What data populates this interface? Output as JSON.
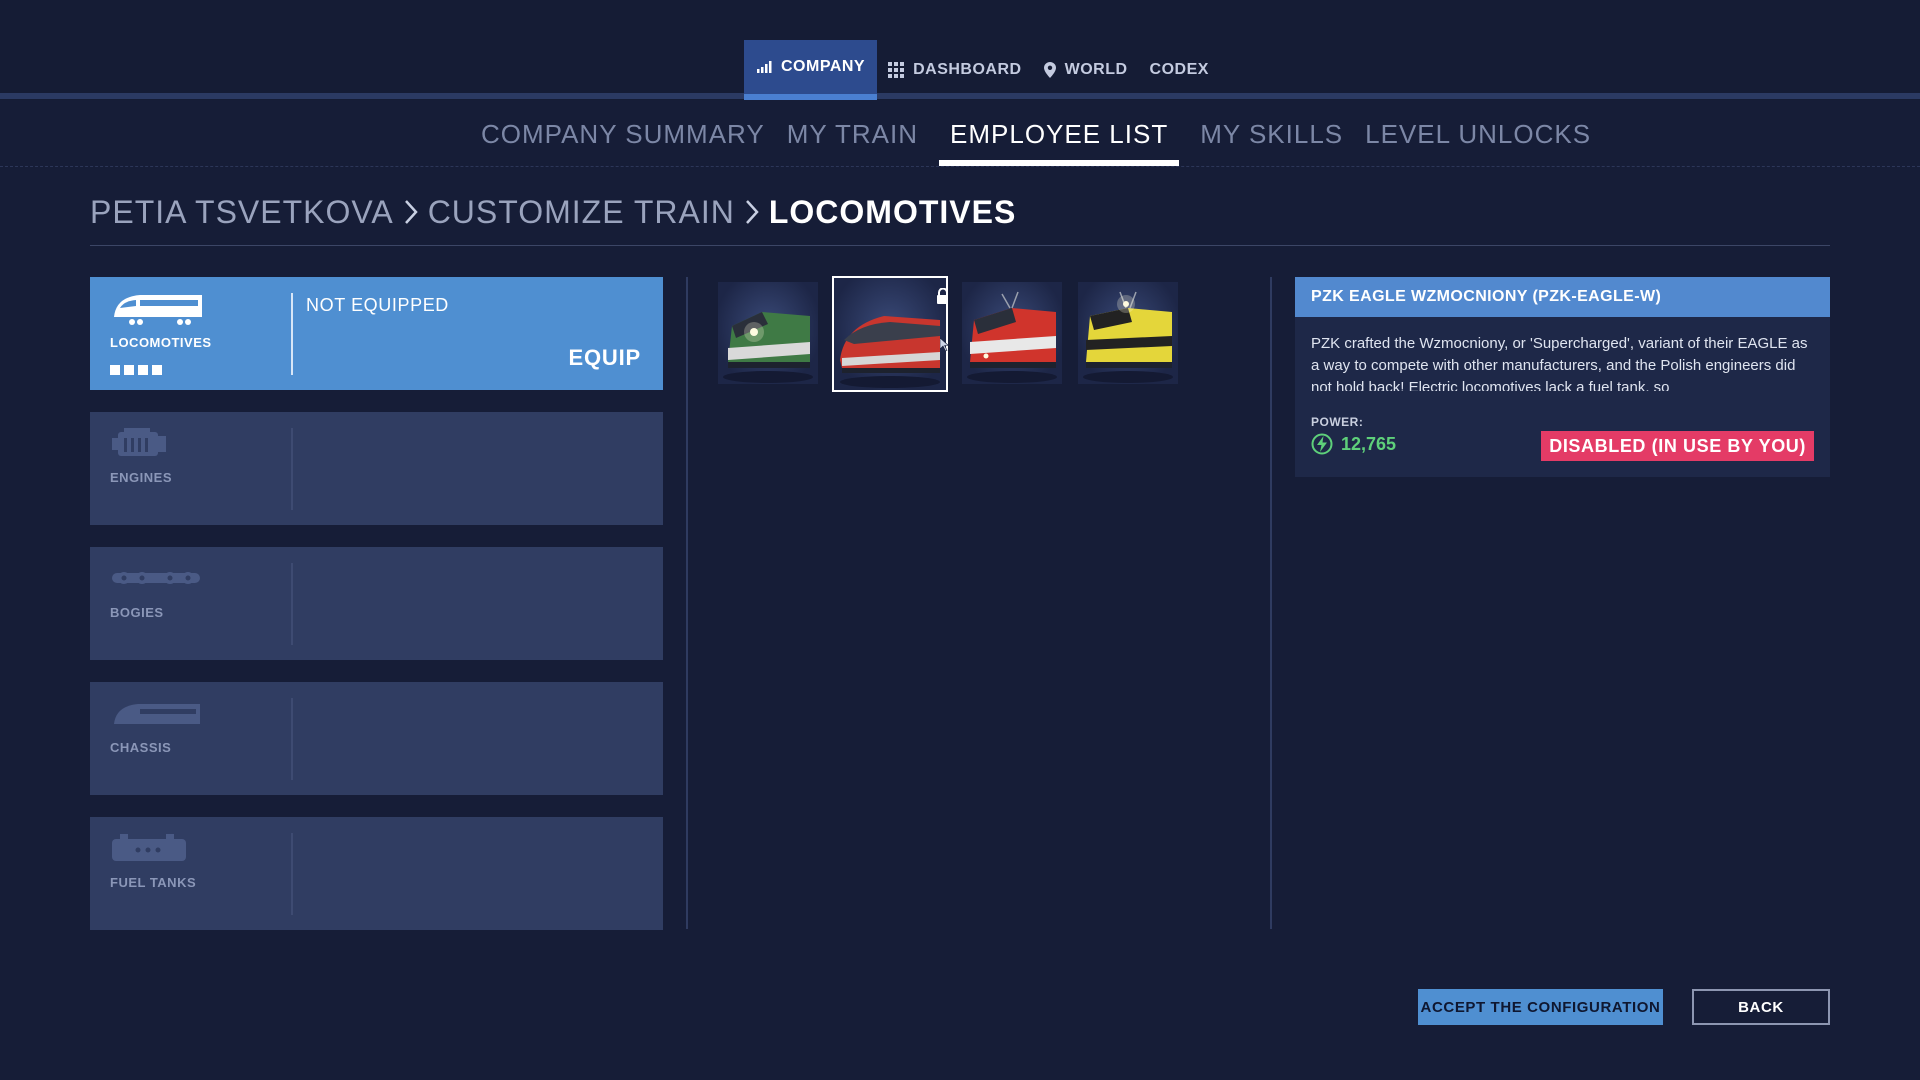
{
  "top_nav": {
    "items": [
      {
        "label": "COMPANY",
        "icon": "signal-bars-icon",
        "active": true
      },
      {
        "label": "DASHBOARD",
        "icon": "grid-icon",
        "active": false
      },
      {
        "label": "WORLD",
        "icon": "map-pin-icon",
        "active": false
      },
      {
        "label": "CODEX",
        "icon": "",
        "active": false
      }
    ]
  },
  "sub_nav": {
    "items": [
      {
        "label": "COMPANY SUMMARY",
        "active": false
      },
      {
        "label": "MY TRAIN",
        "active": false
      },
      {
        "label": "EMPLOYEE LIST",
        "active": true
      },
      {
        "label": "MY SKILLS",
        "active": false
      },
      {
        "label": "LEVEL UNLOCKS",
        "active": false
      }
    ]
  },
  "breadcrumb": {
    "items": [
      "PETIA TSVETKOVA",
      "CUSTOMIZE TRAIN",
      "LOCOMOTIVES"
    ]
  },
  "categories": {
    "items": [
      {
        "label": "LOCOMOTIVES",
        "icon": "locomotive-icon",
        "active": true,
        "status": "NOT EQUIPPED",
        "action": "EQUIP",
        "level_dots": 4
      },
      {
        "label": "ENGINES",
        "icon": "engine-icon",
        "active": false
      },
      {
        "label": "BOGIES",
        "icon": "bogie-icon",
        "active": false
      },
      {
        "label": "CHASSIS",
        "icon": "chassis-icon",
        "active": false
      },
      {
        "label": "FUEL TANKS",
        "icon": "fuel-tank-icon",
        "active": false
      }
    ]
  },
  "thumbnails": {
    "items": [
      {
        "name": "green-locomotive",
        "selected": false,
        "locked": false,
        "body_color": "#3f7a45",
        "accent": "#d9d9d9"
      },
      {
        "name": "red-highspeed-locomotive",
        "selected": true,
        "locked": true,
        "body_color": "#c8362e",
        "accent": "#d6d6d6"
      },
      {
        "name": "red-white-locomotive",
        "selected": false,
        "locked": false,
        "body_color": "#d0342c",
        "accent": "#e8e8e8"
      },
      {
        "name": "yellow-black-locomotive",
        "selected": false,
        "locked": false,
        "body_color": "#e4d63a",
        "accent": "#222222"
      }
    ]
  },
  "detail": {
    "title": "PZK EAGLE WZMOCNIONY (PZK-EAGLE-W)",
    "description": "PZK crafted the Wzmocniony, or 'Supercharged', variant of their EAGLE as a way to compete with other manufacturers, and the Polish engineers did not hold back! Electric locomotives lack a fuel tank, so",
    "power_label": "POWER:",
    "power_value": "12,765",
    "status_badge": "DISABLED (IN USE BY YOU)"
  },
  "buttons": {
    "accept_label": "ACCEPT THE CONFIGURATION",
    "back_label": "BACK"
  },
  "colors": {
    "background": "#161d37",
    "accent_blue": "#4f8fd1",
    "panel": "#303d62",
    "badge_red": "#e43b66",
    "power_green": "#5ed07a"
  }
}
